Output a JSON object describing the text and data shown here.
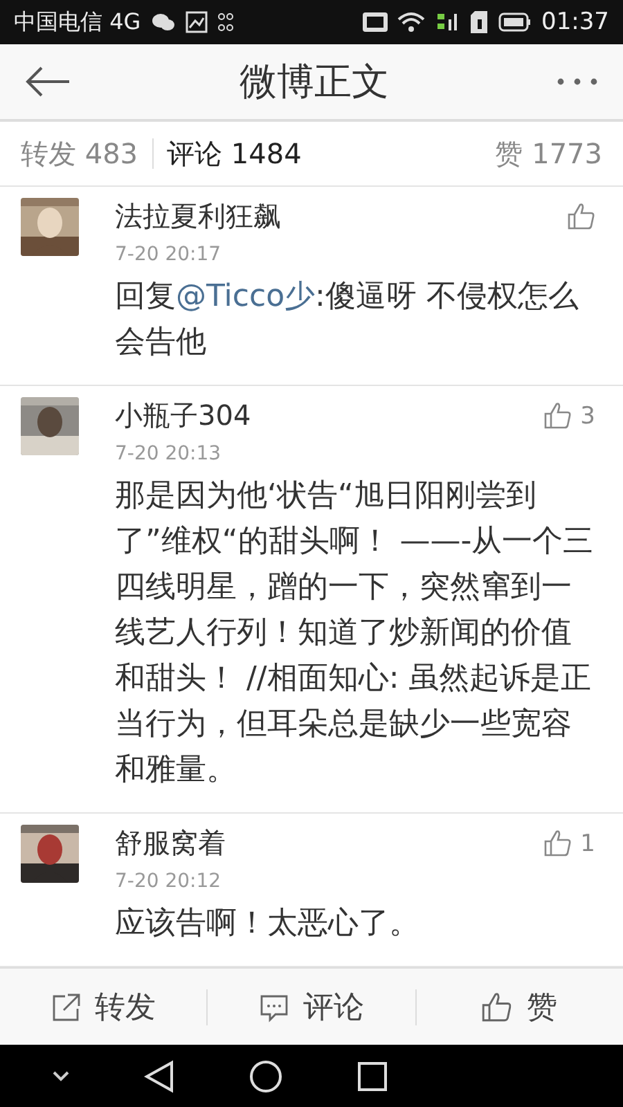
{
  "status_bar": {
    "carrier": "中国电信 4G",
    "time": "01:37"
  },
  "header": {
    "title": "微博正文"
  },
  "tabs": [
    {
      "label": "转发 483",
      "selected": false
    },
    {
      "label": "评论 1484",
      "selected": true
    },
    {
      "label": "赞 1773",
      "selected": false
    }
  ],
  "comments": [
    {
      "kind": "full",
      "name": "法拉夏利狂飙",
      "time": "7-20 20:17",
      "text": [
        {
          "kind": "plain",
          "text": "回复"
        },
        {
          "kind": "mention",
          "text": "@Ticco少"
        },
        {
          "kind": "plain",
          "text": ":傻逼呀  不侵权怎么会告他"
        }
      ]
    },
    {
      "kind": "full",
      "name": "小瓶子304",
      "time": "7-20 20:13",
      "likes": "3",
      "text": [
        {
          "kind": "plain",
          "text": "那是因为他‘状告“旭日阳刚尝到了”维权“的甜头啊！ ——-从一个三四线明星，蹭的一下，突然窜到一线艺人行列！知道了炒新闻的价值和甜头！ //相面知心: 虽然起诉是正当行为，但耳朵总是缺少一些宽容和雅量。"
        }
      ]
    },
    {
      "kind": "full",
      "name": "舒服窝着",
      "time": "7-20 20:12",
      "likes": "1",
      "text": [
        {
          "kind": "plain",
          "text": "应该告啊！太恶心了。"
        }
      ]
    }
  ],
  "actions": [
    {
      "kind": "share",
      "label": "转发"
    },
    {
      "kind": "comment",
      "label": "评论"
    },
    {
      "kind": "like",
      "label": "赞"
    }
  ]
}
